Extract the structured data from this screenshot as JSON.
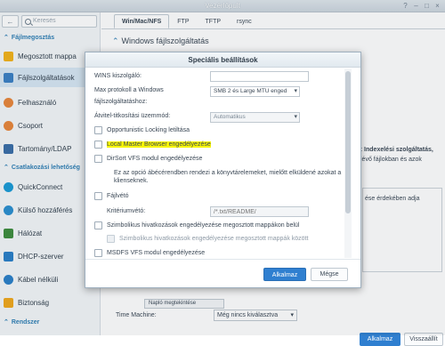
{
  "window": {
    "title": "Vezérlőpult"
  },
  "sidebar": {
    "search_placeholder": "Keresés",
    "sections": [
      {
        "label": "Fájlmegosztás"
      },
      {
        "label": "Csatlakozási lehetőség"
      },
      {
        "label": "Rendszer"
      }
    ],
    "items": [
      {
        "label": "Megosztott mappa",
        "icon": "folder-icon",
        "color": "#f2b21b"
      },
      {
        "label": "Fájlszolgáltatások",
        "icon": "file-services-icon",
        "color": "#3a7fc4",
        "active": true
      },
      {
        "label": "Felhasználó",
        "icon": "user-icon",
        "color": "#e9863a"
      },
      {
        "label": "Csoport",
        "icon": "group-icon",
        "color": "#e9863a"
      },
      {
        "label": "Tartomány/LDAP",
        "icon": "domain-icon",
        "color": "#3a6ea8"
      },
      {
        "label": "QuickConnect",
        "icon": "quickconnect-icon",
        "color": "#1a9bd6"
      },
      {
        "label": "Külső hozzáférés",
        "icon": "external-access-icon",
        "color": "#2a8fd0"
      },
      {
        "label": "Hálózat",
        "icon": "network-icon",
        "color": "#3d8c3d"
      },
      {
        "label": "DHCP-szerver",
        "icon": "dhcp-icon",
        "color": "#2a7fc8"
      },
      {
        "label": "Kábel nélküli",
        "icon": "wireless-icon",
        "color": "#2a7fc8"
      },
      {
        "label": "Biztonság",
        "icon": "shield-icon",
        "color": "#f0a81c"
      }
    ]
  },
  "tabs": [
    {
      "label": "Win/Mac/NFS",
      "active": true
    },
    {
      "label": "FTP"
    },
    {
      "label": "TFTP"
    },
    {
      "label": "rsync"
    }
  ],
  "main": {
    "section_title": "Windows fájlszolgáltatás",
    "bg_text_1": "ás: Indexelési szolgáltatás,",
    "bg_text_2": "lévő fájlokban és azok",
    "bg_text_3": "ése érdekében adja",
    "bg_button_partial": "Napló megtekintése",
    "time_machine_label": "Time Machine:",
    "time_machine_value": "Még nincs kiválasztva",
    "apply_label": "Alkalmaz",
    "reset_label": "Visszaállít"
  },
  "dialog": {
    "title": "Speciális beállítások",
    "wins_label": "WINS kiszolgáló:",
    "wins_value": "",
    "max_protocol_label_1": "Max protokoll a Windows",
    "max_protocol_label_2": "fájlszolgáltatáshoz:",
    "max_protocol_value": "SMB 2 és Large MTU enged",
    "transport_label": "Átvitel-titkosítási üzemmód:",
    "transport_value": "Automatikus",
    "opportunistic_label": "Opportunistic Locking letiltása",
    "local_master_label": "Local Master Browser engedélyezése",
    "dirsort_label": "DirSort VFS modul engedélyezése",
    "dirsort_desc": "Ez az opció ábécérendben rendezi a könyvtárelemeket, mielőtt elküldené azokat a kliens­eknek.",
    "recycle_label": "Fájlvétó",
    "criteria_label": "Kritériumvétó:",
    "criteria_placeholder": "/*.txt/README/",
    "symlink_label": "Szimbolikus hivatkozások engedélyezése megosztott mappákon belül",
    "symlink_cross_label": "Szimbolikus hivatkozások engedélyezése megosztott mappák között",
    "msdfs_label": "MSDFS VFS modul engedélyezése",
    "apply_button": "Alkalmaz",
    "cancel_button": "Mégse"
  }
}
